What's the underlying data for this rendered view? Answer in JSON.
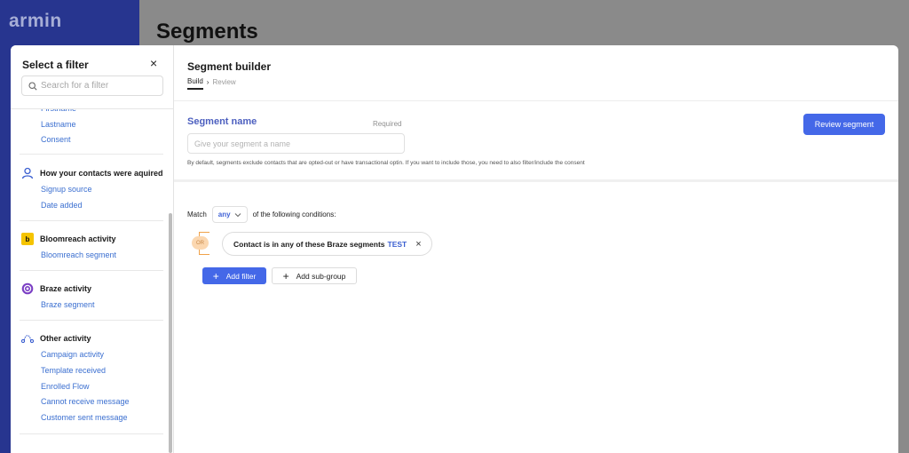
{
  "app": {
    "brand": "armin",
    "page_title": "Segments"
  },
  "filter_panel": {
    "title": "Select a filter",
    "close_label": "×",
    "search_placeholder": "Search for a filter",
    "top_links": [
      "Firstname",
      "Lastname",
      "Consent"
    ],
    "groups": [
      {
        "icon": "person-icon",
        "title": "How your contacts were aquired",
        "links": [
          "Signup source",
          "Date added"
        ]
      },
      {
        "icon": "bloomreach-logo-icon",
        "title": "Bloomreach activity",
        "links": [
          "Bloomreach segment"
        ]
      },
      {
        "icon": "braze-logo-icon",
        "title": "Braze activity",
        "links": [
          "Braze segment"
        ]
      },
      {
        "icon": "journey-icon",
        "title": "Other activity",
        "links": [
          "Campaign activity",
          "Template received",
          "Enrolled Flow",
          "Cannot receive message",
          "Customer sent message"
        ]
      }
    ],
    "icon_letters": {
      "bloomreach": "b"
    }
  },
  "builder": {
    "title": "Segment builder",
    "breadcrumb": {
      "build": "Build",
      "separator": "›",
      "review": "Review"
    },
    "segment_name": {
      "label": "Segment name",
      "required": "Required",
      "placeholder": "Give your segment a name",
      "value": "",
      "hint": "By default, segments exclude contacts that are opted-out or have transactional optin. If you want to include those, you need to also filter/include the consent"
    },
    "review_button": "Review segment",
    "match": {
      "prefix": "Match",
      "value": "any",
      "suffix": "of the following conditions:"
    },
    "or_badge": "OR",
    "condition": {
      "text": "Contact is in any of these Braze segments",
      "value": "TEST",
      "remove": "×"
    },
    "add_filter_button": "Add filter",
    "add_subgroup_button": "Add sub-group",
    "plus": "+"
  },
  "colors": {
    "accent": "#4468e8",
    "link": "#3b6fd0",
    "sidebar": "#27358f",
    "or_orange": "#f0a24a",
    "braze_purple": "#7b3fc4",
    "bloomreach_yellow": "#f5c400"
  }
}
